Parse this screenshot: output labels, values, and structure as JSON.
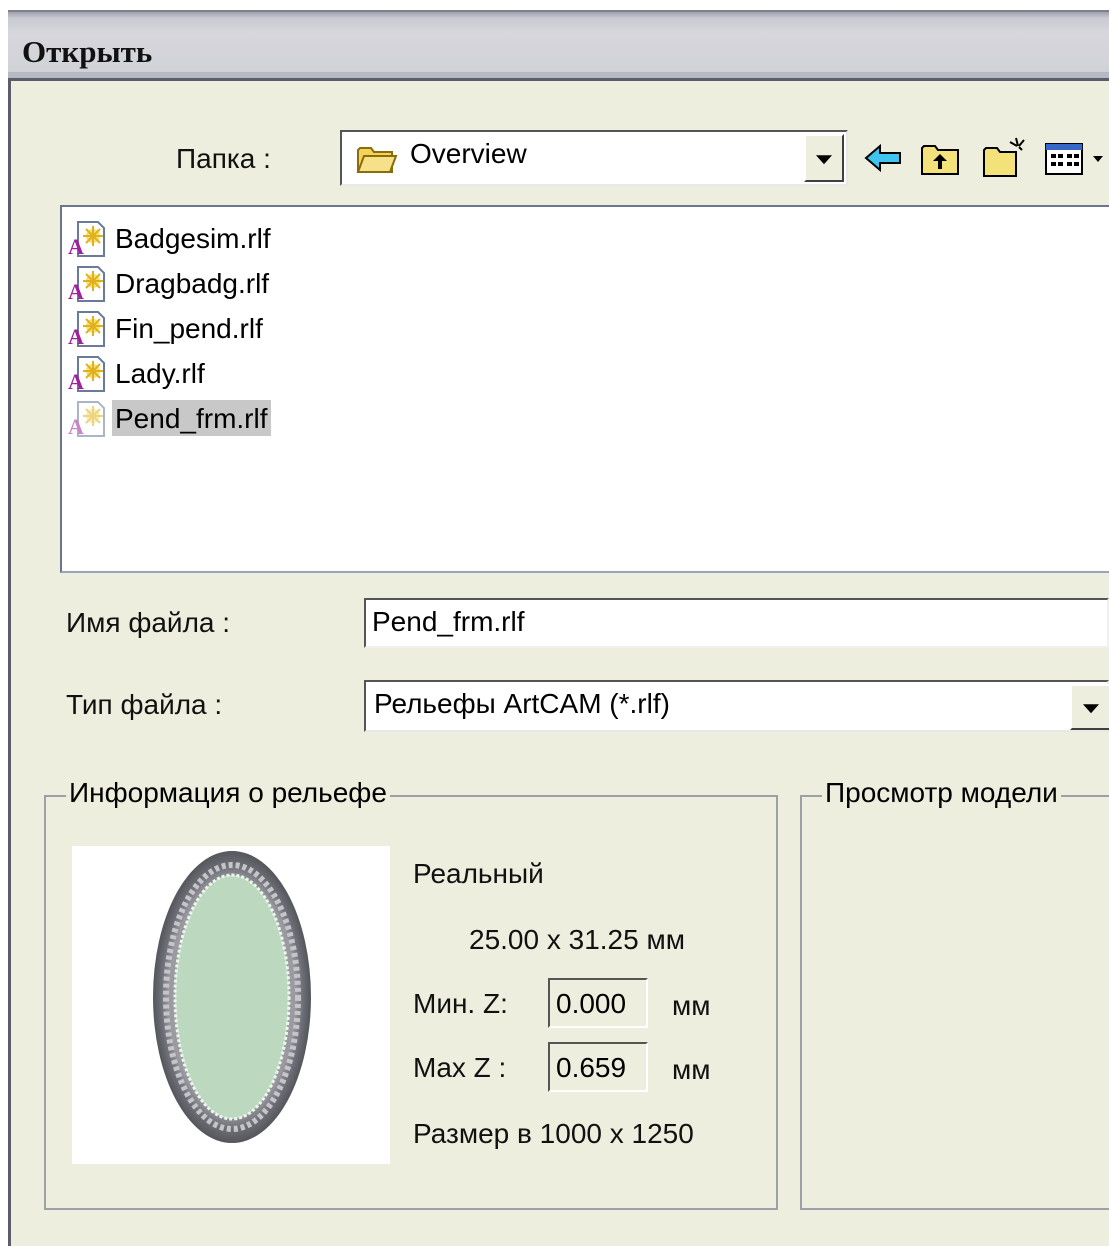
{
  "window": {
    "title": "Открыть"
  },
  "folder": {
    "label": "Папка :",
    "value": "Overview"
  },
  "toolbar_icons": [
    "back-arrow-icon",
    "up-folder-icon",
    "new-folder-icon",
    "view-menu-icon"
  ],
  "files": [
    {
      "name": "Badgesim.rlf",
      "selected": false
    },
    {
      "name": "Dragbadg.rlf",
      "selected": false
    },
    {
      "name": "Fin_pend.rlf",
      "selected": false
    },
    {
      "name": "Lady.rlf",
      "selected": false
    },
    {
      "name": "Pend_frm.rlf",
      "selected": true
    }
  ],
  "filename": {
    "label": "Имя файла :",
    "value": "Pend_frm.rlf"
  },
  "filetype": {
    "label": "Тип файла :",
    "value": "Рельефы ArtCAM (*.rlf)"
  },
  "relief_info": {
    "legend": "Информация о рельефе",
    "mode": "Реальный",
    "dimensions": "25.00 x 31.25 мм",
    "min_z_label": "Мин. Z:",
    "min_z_value": "0.000",
    "max_z_label": "Max Z :",
    "max_z_value": "0.659",
    "unit": "мм",
    "size": "Размер в 1000 x 1250"
  },
  "model_preview": {
    "legend": "Просмотр модели"
  },
  "colors": {
    "selection": "#c8c8c8",
    "dialog_bg": "#eeeedf",
    "relief_fill": "#bcd9c0"
  }
}
